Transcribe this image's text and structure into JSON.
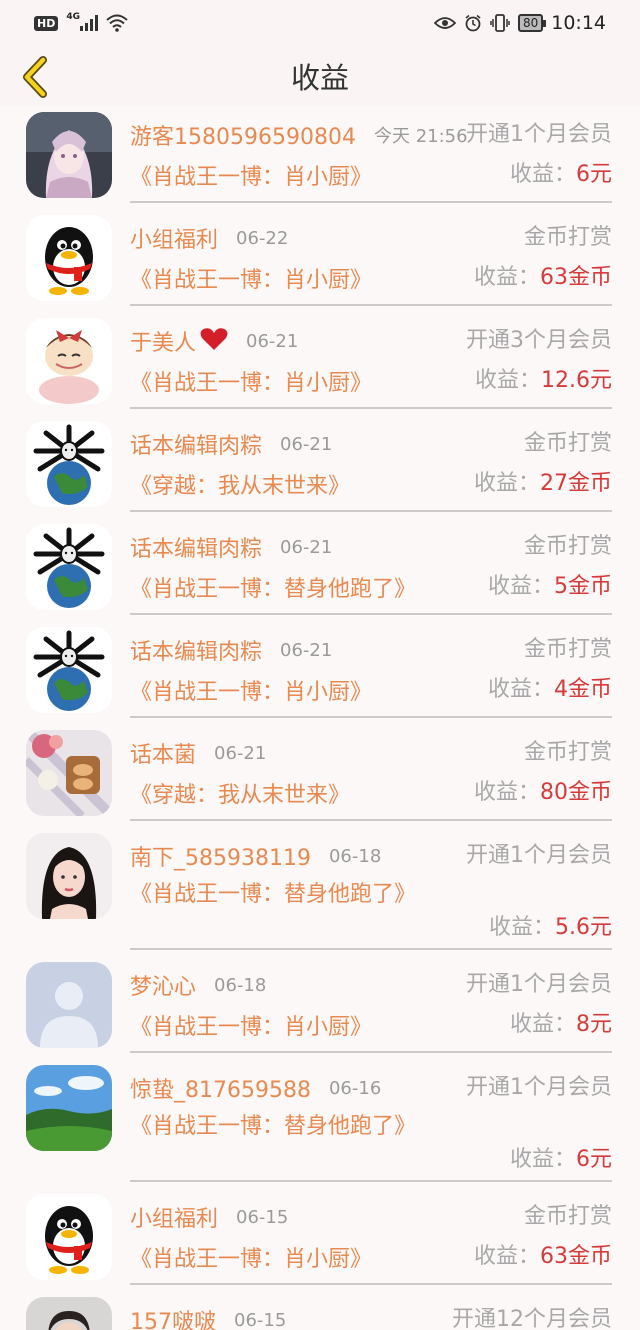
{
  "status_bar": {
    "hd": "HD",
    "network": "4G",
    "battery": "80",
    "time": "10:14"
  },
  "header": {
    "title": "收益",
    "back_icon": "chevron-left-icon"
  },
  "earn_label": "收益：",
  "rows": [
    {
      "name": "游客1580596590804",
      "date": "今天 21:56",
      "type": "开通1个月会员",
      "book": "《肖战王一博：肖小厨》",
      "amount": "6元",
      "avatar": "anime-girl"
    },
    {
      "name": "小组福利",
      "date": "06-22",
      "type": "金币打赏",
      "book": "《肖战王一博：肖小厨》",
      "amount": "63金币",
      "avatar": "penguin"
    },
    {
      "name": "于美人",
      "date": "06-21",
      "type": "开通3个月会员",
      "book": "《肖战王一博：肖小厨》",
      "amount": "12.6元",
      "avatar": "cartoon-girl"
    },
    {
      "name": "话本编辑肉粽",
      "date": "06-21",
      "type": "金币打赏",
      "book": "《穿越：我从末世来》",
      "amount": "27金币",
      "avatar": "meme-earth"
    },
    {
      "name": "话本编辑肉粽",
      "date": "06-21",
      "type": "金币打赏",
      "book": "《肖战王一博：替身他跑了》",
      "amount": "5金币",
      "avatar": "meme-earth"
    },
    {
      "name": "话本编辑肉粽",
      "date": "06-21",
      "type": "金币打赏",
      "book": "《肖战王一博：肖小厨》",
      "amount": "4金币",
      "avatar": "meme-earth"
    },
    {
      "name": "话本菌",
      "date": "06-21",
      "type": "金币打赏",
      "book": "《穿越：我从末世来》",
      "amount": "80金币",
      "avatar": "food-photo"
    },
    {
      "name": "南下_585938119",
      "date": "06-18",
      "type": "开通1个月会员",
      "book": "《肖战王一博：替身他跑了》",
      "amount": "5.6元",
      "avatar": "woman-photo",
      "tall": true
    },
    {
      "name": "梦沁心",
      "date": "06-18",
      "type": "开通1个月会员",
      "book": "《肖战王一博：肖小厨》",
      "amount": "8元",
      "avatar": "default-person"
    },
    {
      "name": "惊蛰_817659588",
      "date": "06-16",
      "type": "开通1个月会员",
      "book": "《肖战王一博：替身他跑了》",
      "amount": "6元",
      "avatar": "landscape",
      "tall": true
    },
    {
      "name": "小组福利",
      "date": "06-15",
      "type": "金币打赏",
      "book": "《肖战王一博：肖小厨》",
      "amount": "63金币",
      "avatar": "penguin"
    },
    {
      "name": "157啵啵",
      "date": "06-15",
      "type": "开通12个月会员",
      "book": "",
      "amount": "",
      "avatar": "man-photo"
    }
  ]
}
